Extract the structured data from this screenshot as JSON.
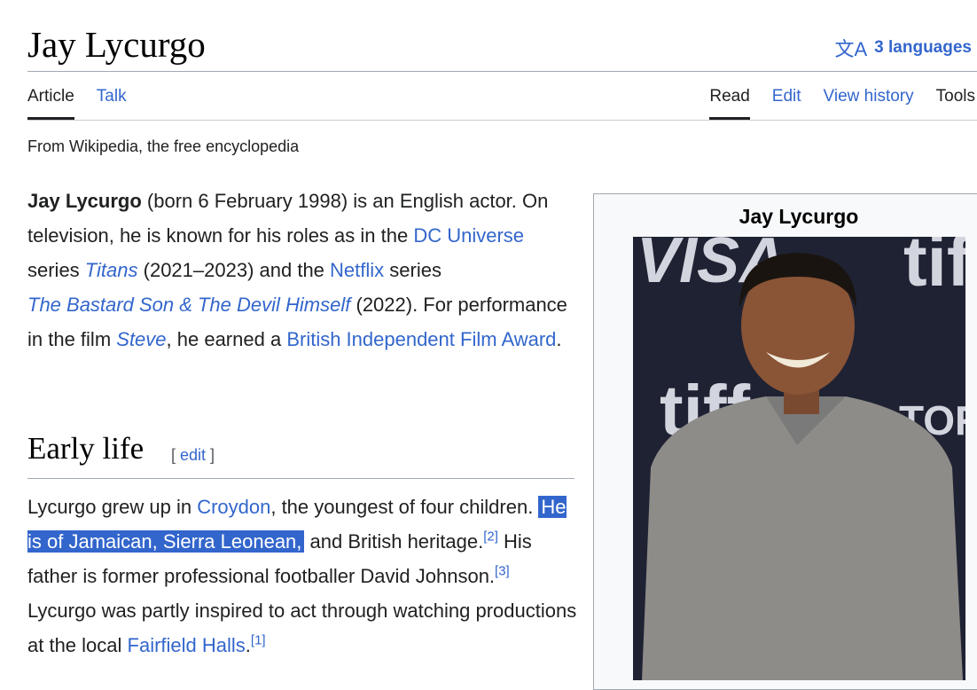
{
  "page": {
    "title": "Jay Lycurgo",
    "languages": "3 languages",
    "tagline": "From Wikipedia, the free encyclopedia"
  },
  "tabs": {
    "article": "Article",
    "talk": "Talk",
    "read": "Read",
    "edit": "Edit",
    "history": "View history",
    "tools": "Tools"
  },
  "lead": [
    "Jay Lycurgo",
    " (born 6 February 1998) is an English actor. On television, he is known for his roles as in the ",
    "DC Universe",
    " series ",
    "Titans",
    " (2021–2023) and the ",
    "Netflix",
    " series ",
    "The Bastard Son & The Devil Himself",
    " (2022). For performance in the film ",
    "Steve",
    ", he earned a ",
    "British Independent Film Award",
    "."
  ],
  "section": {
    "heading": "Early life",
    "edit": "[ edit ]"
  },
  "early": [
    "Lycurgo grew up in ",
    "Croydon",
    ", the youngest of four children. ",
    "He is of Jamaican, Sierra Leonean,",
    " and British heritage.",
    "[2]",
    " His father is former professional footballer David Johnson.",
    "[3]",
    " Lycurgo was partly inspired to act through watching productions at the local ",
    "Fairfield Halls",
    ".",
    "[1]"
  ],
  "infobox": {
    "title": "Jay Lycurgo",
    "photo_text": [
      "VISA",
      "tiff",
      "tiff",
      "TORO"
    ]
  }
}
